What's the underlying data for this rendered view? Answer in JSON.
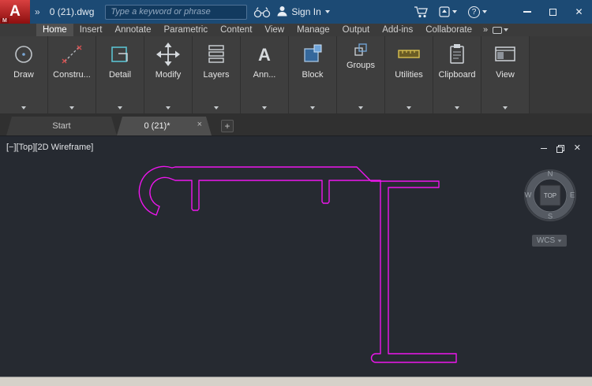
{
  "titlebar": {
    "logo_letter": "A",
    "logo_sub": "M",
    "overflow": "»",
    "doc_title": "0 (21).dwg",
    "search_placeholder": "Type a keyword or phrase",
    "sign_in": "Sign In",
    "help": "?",
    "close_glyph": "✕"
  },
  "ribbon": {
    "tabs": [
      {
        "label": "Home",
        "active": true
      },
      {
        "label": "Insert"
      },
      {
        "label": "Annotate"
      },
      {
        "label": "Parametric"
      },
      {
        "label": "Content"
      },
      {
        "label": "View"
      },
      {
        "label": "Manage"
      },
      {
        "label": "Output"
      },
      {
        "label": "Add-ins"
      },
      {
        "label": "Collaborate"
      }
    ],
    "overflow": "»",
    "ann_glyph": "A",
    "panels": [
      {
        "label": "Draw"
      },
      {
        "label": "Constru..."
      },
      {
        "label": "Detail"
      },
      {
        "label": "Modify"
      },
      {
        "label": "Layers"
      },
      {
        "label": "Ann..."
      },
      {
        "label": "Block"
      },
      {
        "label": "Groups"
      },
      {
        "label": "Utilities"
      },
      {
        "label": "Clipboard"
      },
      {
        "label": "View"
      }
    ]
  },
  "filetabs": {
    "tabs": [
      {
        "label": "Start"
      },
      {
        "label": "0 (21)*",
        "active": true
      }
    ],
    "close_glyph": "×",
    "new_tab": "+"
  },
  "viewport": {
    "controls": {
      "collapse": "[−]",
      "view": "[Top]",
      "visual_style": "[2D Wireframe]"
    },
    "viewcube": {
      "n": "N",
      "e": "E",
      "s": "S",
      "w": "W",
      "face": "TOP"
    },
    "wcs": "WCS",
    "close_glyph": "✕",
    "shape_color": "#ee16ee"
  }
}
